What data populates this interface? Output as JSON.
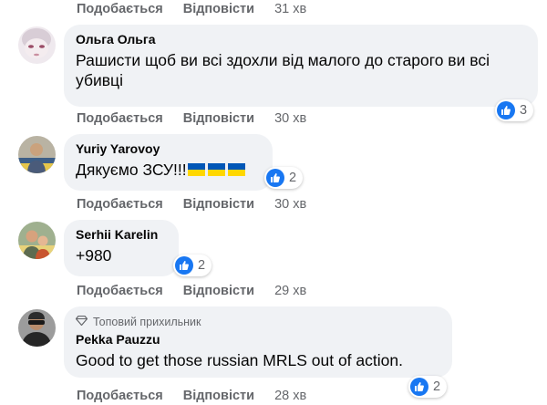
{
  "actions": {
    "like_label": "Подобається",
    "reply_label": "Відповісти"
  },
  "comments": [
    {
      "author": "",
      "text": "",
      "time": "31 хв",
      "reactions": null
    },
    {
      "author": "Ольга Ольга",
      "text": "Рашисти щоб ви всі здохли від малого до старого ви всі убивці",
      "time": "30 хв",
      "reactions": "3"
    },
    {
      "author": "Yuriy Yarovoy",
      "text": "Дякуємо ЗСУ!!!",
      "emoji": "ukraine-flag-x3",
      "time": "30 хв",
      "reactions": "2"
    },
    {
      "author": "Serhii Karelin",
      "text": "+980",
      "time": "29 хв",
      "reactions": "2"
    },
    {
      "author": "Pekka Pauzzu",
      "badge": "Топовий прихильник",
      "text": "Good to get those russian MRLS out of action.",
      "time": "28 хв",
      "reactions": "2"
    }
  ],
  "colors": {
    "bubble": "#f0f2f5",
    "meta": "#65676b",
    "like_blue": "#1877f2",
    "flag_blue": "#0057b7",
    "flag_yellow": "#ffd700"
  }
}
